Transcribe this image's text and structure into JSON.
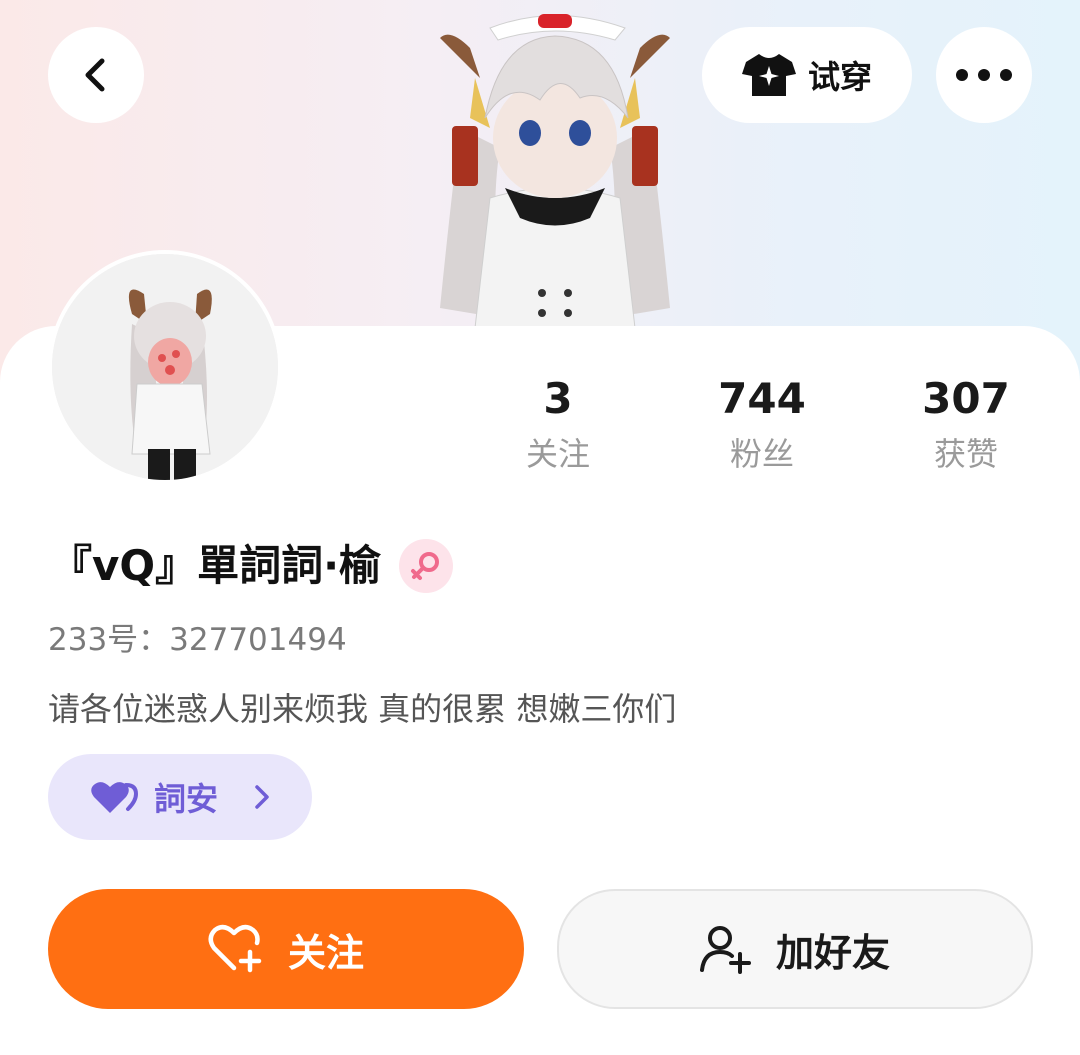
{
  "header": {
    "try_on_label": "试穿",
    "back_icon": "chevron-left-icon",
    "more_icon": "more-dots-icon",
    "try_on_icon": "tshirt-icon"
  },
  "profile": {
    "name": "『vQ』單詞詞·榆",
    "gender_icon": "female-icon",
    "uid": "233号：327701494",
    "bio": "请各位迷惑人别来烦我 真的很累  想嫩三你们"
  },
  "stats": {
    "following": {
      "value": "3",
      "label": "关注"
    },
    "fans": {
      "value": "744",
      "label": "粉丝"
    },
    "likes": {
      "value": "307",
      "label": "获赞"
    }
  },
  "tag": {
    "label": "詞安",
    "icon": "heart-pair-icon"
  },
  "actions": {
    "follow_label": "关注",
    "add_friend_label": "加好友"
  },
  "colors": {
    "accent_orange": "#ff6f12",
    "tag_purple": "#6f5dd6",
    "tag_bg": "#e9e6fb",
    "gender_pink": "#f06a8c"
  }
}
